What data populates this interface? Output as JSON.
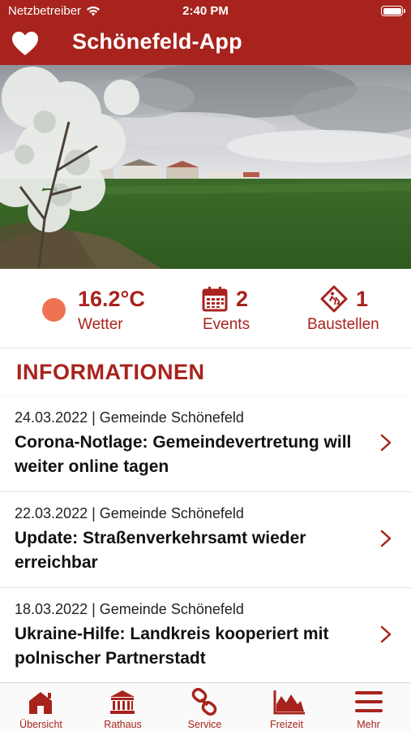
{
  "status_bar": {
    "carrier": "Netzbetreiber",
    "time": "2:40 PM"
  },
  "header": {
    "title": "Schönefeld-App",
    "icon": "heart-icon"
  },
  "stats": {
    "weather": {
      "value": "16.2°C",
      "label": "Wetter",
      "icon": "sun-icon"
    },
    "events": {
      "value": "2",
      "label": "Events",
      "icon": "calendar-icon"
    },
    "construction": {
      "value": "1",
      "label": "Baustellen",
      "icon": "roadwork-sign-icon"
    }
  },
  "section": {
    "title": "INFORMATIONEN"
  },
  "news": [
    {
      "meta": "24.03.2022 | Gemeinde Schönefeld",
      "headline": "Corona-Notlage: Gemeindevertretung will weiter online tagen"
    },
    {
      "meta": "22.03.2022 | Gemeinde Schönefeld",
      "headline": "Update: Straßenverkehrsamt wieder erreichbar"
    },
    {
      "meta": "18.03.2022 | Gemeinde Schönefeld",
      "headline": "Ukraine-Hilfe: Landkreis kooperiert mit polnischer Partnerstadt"
    }
  ],
  "tabs": [
    {
      "label": "Übersicht",
      "icon": "house-icon"
    },
    {
      "label": "Rathaus",
      "icon": "town-hall-icon"
    },
    {
      "label": "Service",
      "icon": "chain-link-icon"
    },
    {
      "label": "Freizeit",
      "icon": "landscape-icon"
    },
    {
      "label": "Mehr",
      "icon": "menu-icon"
    }
  ],
  "colors": {
    "brand": "#a8231d",
    "sun": "#ef7352"
  }
}
